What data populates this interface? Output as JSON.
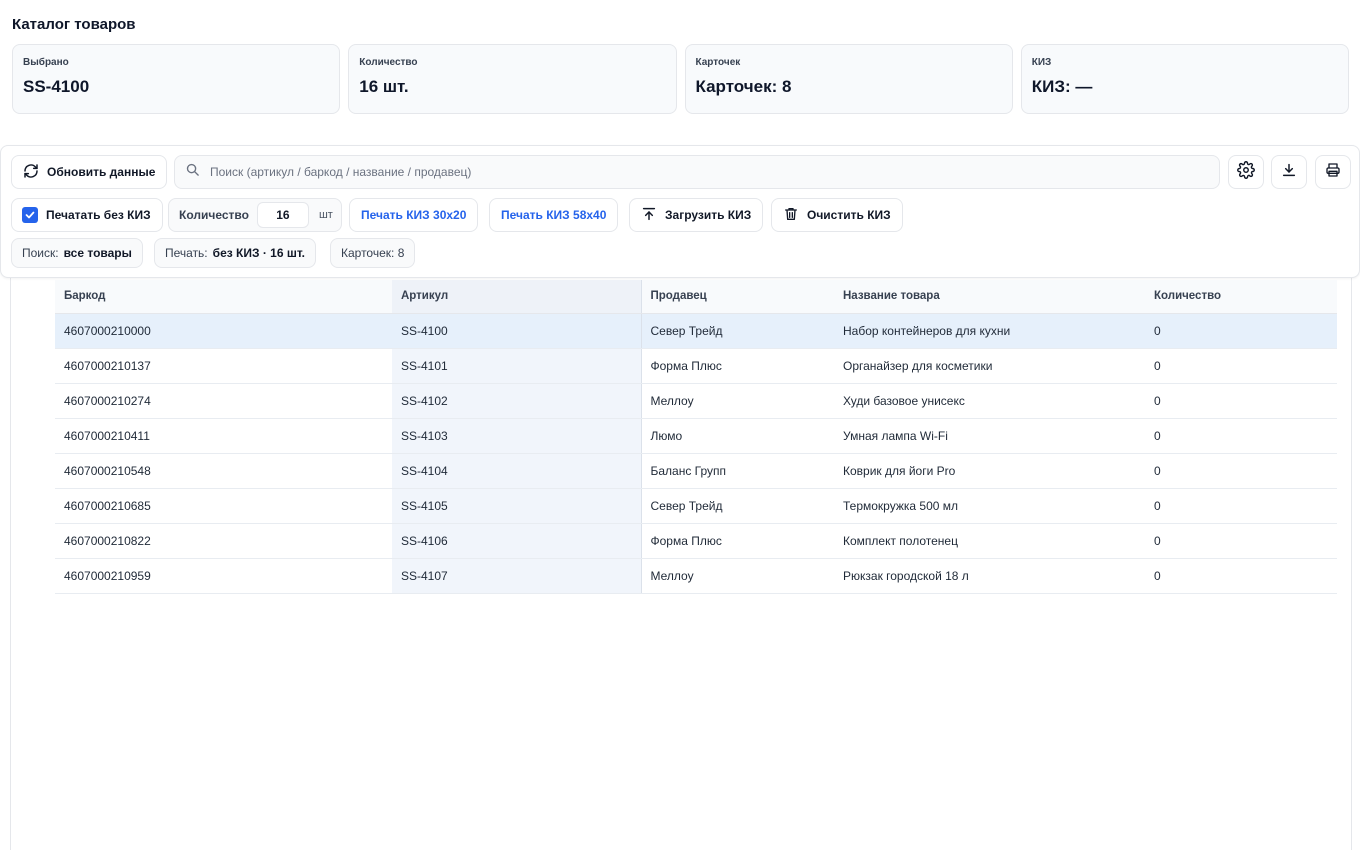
{
  "page": {
    "title": "Каталог товаров"
  },
  "stats": [
    {
      "label": "Выбрано",
      "value": "SS-4100"
    },
    {
      "label": "Количество",
      "value": "16 шт."
    },
    {
      "label": "Карточек",
      "value": "Карточек: 8"
    },
    {
      "label": "КИЗ",
      "value": "КИЗ: —"
    }
  ],
  "toolbar": {
    "refresh_label": "Обновить данные",
    "search_placeholder": "Поиск (артикул / баркод / название / продавец)",
    "search_value": "",
    "print_without_kiz_label": "Печатать без КИЗ",
    "print_without_kiz_checked": true,
    "quantity_label": "Количество",
    "quantity_value": "16",
    "quantity_unit": "шт",
    "print_kiz_30x20_label": "Печать КИЗ 30x20",
    "print_kiz_58x40_label": "Печать КИЗ 58x40",
    "upload_kiz_label": "Загрузить КИЗ",
    "clear_kiz_label": "Очистить КИЗ",
    "icons": [
      "settings-icon",
      "download-icon",
      "print-icon"
    ]
  },
  "chips": [
    {
      "key": "Поиск:",
      "value": "все товары"
    },
    {
      "key": "Печать:",
      "value": "без КИЗ · 16 шт."
    },
    {
      "key": "Карточек: 8",
      "value": ""
    }
  ],
  "table": {
    "columns": [
      "Баркод",
      "Артикул",
      "Продавец",
      "Название товара",
      "Количество"
    ],
    "selected_index": 0,
    "rows": [
      {
        "barcode": "4607000210000",
        "article": "SS-4100",
        "seller": "Север Трейд",
        "name": "Набор контейнеров для кухни",
        "qty": "0"
      },
      {
        "barcode": "4607000210137",
        "article": "SS-4101",
        "seller": "Форма Плюс",
        "name": "Органайзер для косметики",
        "qty": "0"
      },
      {
        "barcode": "4607000210274",
        "article": "SS-4102",
        "seller": "Меллоу",
        "name": "Худи базовое унисекс",
        "qty": "0"
      },
      {
        "barcode": "4607000210411",
        "article": "SS-4103",
        "seller": "Люмо",
        "name": "Умная лампа Wi-Fi",
        "qty": "0"
      },
      {
        "barcode": "4607000210548",
        "article": "SS-4104",
        "seller": "Баланс Групп",
        "name": "Коврик для йоги Pro",
        "qty": "0"
      },
      {
        "barcode": "4607000210685",
        "article": "SS-4105",
        "seller": "Север Трейд",
        "name": "Термокружка 500 мл",
        "qty": "0"
      },
      {
        "barcode": "4607000210822",
        "article": "SS-4106",
        "seller": "Форма Плюс",
        "name": "Комплект полотенец",
        "qty": "0"
      },
      {
        "barcode": "4607000210959",
        "article": "SS-4107",
        "seller": "Меллоу",
        "name": "Рюкзак городской 18 л",
        "qty": "0"
      }
    ]
  },
  "colors": {
    "accent": "#2563eb",
    "selected_row": "#e6f0fb",
    "article_column": "#f1f5fb"
  }
}
